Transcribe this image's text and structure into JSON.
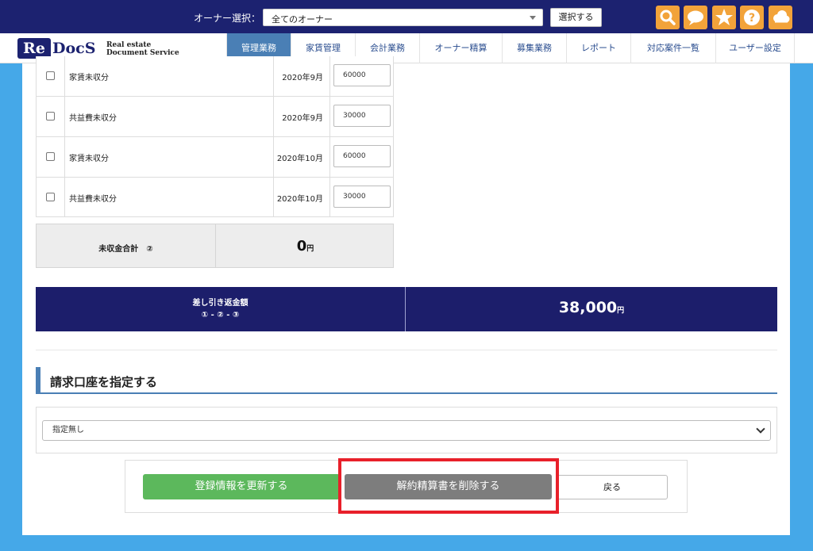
{
  "topbar": {
    "owner_label": "オーナー選択：",
    "owner_select_value": "全てのオーナー",
    "select_button": "選択する",
    "icons": [
      "search-icon",
      "chat-icon",
      "star-icon",
      "help-icon",
      "cloud-icon"
    ],
    "icon_color": "#f2a33a",
    "bg_color": "#1c2270"
  },
  "logo": {
    "re": "Re",
    "docs": "DocS",
    "tag_line1": "Real estate",
    "tag_line2": "Document Service"
  },
  "nav": {
    "tabs": [
      {
        "label": "管理業務",
        "active": true
      },
      {
        "label": "家賃管理",
        "active": false
      },
      {
        "label": "会計業務",
        "active": false
      },
      {
        "label": "オーナー精算",
        "active": false
      },
      {
        "label": "募集業務",
        "active": false
      },
      {
        "label": "レポート",
        "active": false
      },
      {
        "label": "対応案件一覧",
        "active": false
      },
      {
        "label": "ユーザー設定",
        "active": false
      }
    ]
  },
  "rows": [
    {
      "name": "家賃未収分",
      "month": "2020年9月",
      "amount": "60000"
    },
    {
      "name": "共益費未収分",
      "month": "2020年9月",
      "amount": "30000"
    },
    {
      "name": "家賃未収分",
      "month": "2020年10月",
      "amount": "60000"
    },
    {
      "name": "共益費未収分",
      "month": "2020年10月",
      "amount": "30000"
    }
  ],
  "unpaid_total": {
    "label": "未収金合計　②",
    "value": "0",
    "unit": "円"
  },
  "refund": {
    "label_line1": "差し引き返金額",
    "label_line2": "① - ② - ③",
    "value": "38,000",
    "unit": "円",
    "bg_color": "#1c1e6b"
  },
  "billing": {
    "title": "請求口座を指定する",
    "select_value": "指定無し"
  },
  "actions": {
    "update": "登録情報を更新する",
    "delete": "解約精算書を削除する",
    "back": "戻る",
    "update_color": "#5cb85c",
    "delete_color": "#7d7d7d",
    "highlight_color": "#e8202a"
  }
}
